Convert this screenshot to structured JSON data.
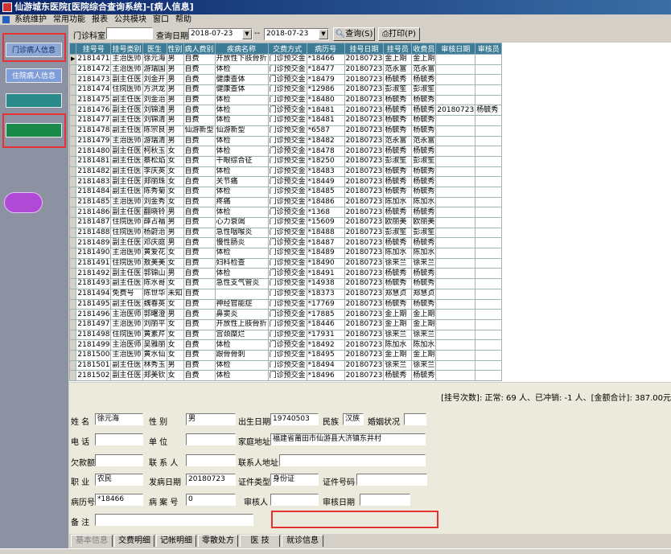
{
  "window": {
    "title": "仙游城东医院[医院综合查询系统]-[病人信息]"
  },
  "menu": [
    "系统维护",
    "常用功能",
    "报表",
    "公共模块",
    "窗口",
    "帮助"
  ],
  "sidebar": {
    "outpatient": "门诊病人信息",
    "inpatient": "住院病人信息",
    "item3": "",
    "item4": "",
    "item5": ""
  },
  "toolbar": {
    "dept_label": "门诊科室",
    "dept_value": "",
    "date_label": "查询日期",
    "date_from": "2018-07-23",
    "date_sep": "--",
    "date_to": "2018-07-23",
    "query": "查询(S)",
    "print": "打印(P)"
  },
  "grid": {
    "headers": [
      "挂号号",
      "挂号类别",
      "医生",
      "性别",
      "病人费别",
      "疾病名称",
      "交费方式",
      "病历号",
      "挂号日期",
      "挂号员",
      "收费员",
      "审核日期",
      "审核员"
    ],
    "rows": [
      [
        "2181471",
        "主治医师",
        "徐元海",
        "男",
        "自费",
        "开放性下肢骨折",
        "门诊预交金",
        "*18466",
        "20180723",
        "金上期",
        "金上期",
        "",
        ""
      ],
      [
        "2181472",
        "主治医师",
        "游瑞国",
        "男",
        "自费",
        "体检",
        "门诊预交金",
        "*18477",
        "20180723",
        "范永富",
        "范永富",
        "",
        ""
      ],
      [
        "2181473",
        "副主任医",
        "刘金开",
        "男",
        "自费",
        "健康查体",
        "门诊预交金",
        "*18479",
        "20180723",
        "杨毓秀",
        "杨毓秀",
        "",
        ""
      ],
      [
        "2181474",
        "住院医师",
        "方洪龙",
        "男",
        "自费",
        "健康查体",
        "门诊预交金",
        "*12986",
        "20180723",
        "彭淑笙",
        "彭淑笙",
        "",
        ""
      ],
      [
        "2181475",
        "副主任医",
        "刘金治",
        "男",
        "自费",
        "体检",
        "门诊预交金",
        "*18480",
        "20180723",
        "杨毓秀",
        "杨毓秀",
        "",
        ""
      ],
      [
        "2181476",
        "副主任医",
        "刘锦清",
        "男",
        "自费",
        "体检",
        "门诊预交金",
        "*18481",
        "20180723",
        "杨毓秀",
        "杨毓秀",
        "20180723",
        "杨毓秀"
      ],
      [
        "2181477",
        "副主任医",
        "刘锦清",
        "男",
        "自费",
        "体检",
        "门诊预交金",
        "*18481",
        "20180723",
        "杨毓秀",
        "杨毓秀",
        "",
        ""
      ],
      [
        "2181478",
        "副主任医",
        "陈宗良",
        "男",
        "仙游新型",
        "仙游新型",
        "门诊预交金",
        "*6587",
        "20180723",
        "杨毓秀",
        "杨毓秀",
        "",
        ""
      ],
      [
        "2181479",
        "主治医师",
        "游瑞清",
        "男",
        "自费",
        "体检",
        "门诊预交金",
        "*18482",
        "20180723",
        "范永富",
        "范永富",
        "",
        ""
      ],
      [
        "2181480",
        "副主任医",
        "柯秋玉",
        "女",
        "自费",
        "体检",
        "门诊预交金",
        "*18478",
        "20180723",
        "杨毓秀",
        "杨毓秀",
        "",
        ""
      ],
      [
        "2181481",
        "副主任医",
        "蔡松焰",
        "女",
        "自费",
        "干眼综合征",
        "门诊预交金",
        "*18250",
        "20180723",
        "彭淑笙",
        "彭淑笙",
        "",
        ""
      ],
      [
        "2181482",
        "副主任医",
        "李庆英",
        "女",
        "自费",
        "体检",
        "门诊预交金",
        "*18483",
        "20180723",
        "杨毓秀",
        "杨毓秀",
        "",
        ""
      ],
      [
        "2181483",
        "副主任医",
        "郑丽珠",
        "女",
        "自费",
        "关节痛",
        "门诊预交金",
        "*18449",
        "20180723",
        "杨毓秀",
        "杨毓秀",
        "",
        ""
      ],
      [
        "2181484",
        "副主任医",
        "陈秀菊",
        "女",
        "自费",
        "体检",
        "门诊预交金",
        "*18485",
        "20180723",
        "杨毓秀",
        "杨毓秀",
        "",
        ""
      ],
      [
        "2181485",
        "主治医师",
        "刘金秀",
        "女",
        "自费",
        "疼痛",
        "门诊预交金",
        "*18486",
        "20180723",
        "陈加水",
        "陈加水",
        "",
        ""
      ],
      [
        "2181486",
        "副主任医",
        "翻晓铃",
        "男",
        "自费",
        "体检",
        "门诊预交金",
        "*1368",
        "20180723",
        "杨毓秀",
        "杨毓秀",
        "",
        ""
      ],
      [
        "2181487",
        "住院医师",
        "薛占福",
        "男",
        "自费",
        "心力衰竭",
        "门诊预交金",
        "*15609",
        "20180723",
        "欧丽美",
        "欧丽美",
        "",
        ""
      ],
      [
        "2181488",
        "住院医师",
        "杨蔚治",
        "男",
        "自费",
        "急性咽喉炎",
        "门诊预交金",
        "*18488",
        "20180723",
        "彭淑笙",
        "彭淑笙",
        "",
        ""
      ],
      [
        "2181489",
        "副主任医",
        "邓庆庭",
        "男",
        "自费",
        "慢性肠炎",
        "门诊预交金",
        "*18487",
        "20180723",
        "杨毓秀",
        "杨毓秀",
        "",
        ""
      ],
      [
        "2181490",
        "主治医师",
        "黄爱花",
        "女",
        "自费",
        "体检",
        "门诊预交金",
        "*18489",
        "20180723",
        "陈加水",
        "陈加水",
        "",
        ""
      ],
      [
        "2181491",
        "住院医师",
        "敖美美",
        "女",
        "自费",
        "妇科检查",
        "门诊预交金",
        "*18490",
        "20180723",
        "徐来兰",
        "徐来兰",
        "",
        ""
      ],
      [
        "2181492",
        "副主任医",
        "郭锦山",
        "男",
        "自费",
        "体检",
        "门诊预交金",
        "*18491",
        "20180723",
        "杨毓秀",
        "杨毓秀",
        "",
        ""
      ],
      [
        "2181493",
        "副主任医",
        "陈水哥",
        "女",
        "自费",
        "急性支气管炎",
        "门诊预交金",
        "*14938",
        "20180723",
        "杨毓秀",
        "杨毓秀",
        "",
        ""
      ],
      [
        "2181494",
        "免费号",
        "陈世华",
        "未知",
        "自费",
        "",
        "门诊预交金",
        "*18373",
        "20180723",
        "郑慧贞",
        "郑慧贞",
        "",
        ""
      ],
      [
        "2181495",
        "副主任医",
        "魏春英",
        "女",
        "自费",
        "神经官能症",
        "门诊预交金",
        "*17769",
        "20180723",
        "杨毓秀",
        "杨毓秀",
        "",
        ""
      ],
      [
        "2181496",
        "主治医师",
        "郭曙澄",
        "男",
        "自费",
        "鼻窦炎",
        "门诊预交金",
        "*17885",
        "20180723",
        "金上期",
        "金上期",
        "",
        ""
      ],
      [
        "2181497",
        "主治医师",
        "刘丽平",
        "女",
        "自费",
        "开放性上肢骨折",
        "门诊预交金",
        "*18446",
        "20180723",
        "金上期",
        "金上期",
        "",
        ""
      ],
      [
        "2181498",
        "住院医师",
        "黄素芹",
        "女",
        "自费",
        "宫颈糜烂",
        "门诊预交金",
        "*17931",
        "20180723",
        "徐来兰",
        "徐来兰",
        "",
        ""
      ],
      [
        "2181499",
        "主治医师",
        "吴雅丽",
        "女",
        "自费",
        "体检",
        "门诊预交金",
        "*18492",
        "20180723",
        "陈加水",
        "陈加水",
        "",
        ""
      ],
      [
        "2181500",
        "主治医师",
        "黄水仙",
        "女",
        "自费",
        "跟骨骨刺",
        "门诊预交金",
        "*18495",
        "20180723",
        "金上期",
        "金上期",
        "",
        ""
      ],
      [
        "2181501",
        "副主任医",
        "林秀玉",
        "男",
        "自费",
        "体检",
        "门诊预交金",
        "*18494",
        "20180723",
        "徐来兰",
        "徐来兰",
        "",
        ""
      ],
      [
        "2181502",
        "副主任医",
        "郑美钦",
        "女",
        "自费",
        "体检",
        "门诊预交金",
        "*18496",
        "20180723",
        "杨毓秀",
        "杨毓秀",
        "",
        ""
      ]
    ]
  },
  "summary": "[挂号次数]: 正常: 69 人、已冲销: -1 人、[金额合计]: 387.00元",
  "form": {
    "name_label": "姓    名",
    "name": "徐元海",
    "sex_label": "性    别",
    "sex": "男",
    "birth_label": "出生日期",
    "birth": "19740503",
    "ethnic_label": "民族",
    "ethnic": "汉族",
    "marital_label": "婚姻状况",
    "marital": "",
    "phone_label": "电    话",
    "phone": "",
    "unit_label": "单    位",
    "unit": "",
    "address_label": "家庭地址",
    "address": "福建省莆田市仙游县大济镇东井村",
    "debt_label": "欠款额",
    "debt": "",
    "contact_label": "联 系 人",
    "contact": "",
    "contact_addr_label": "联系人地址",
    "contact_addr": "",
    "job_label": "职    业",
    "job": "农民",
    "onset_label": "发病日期",
    "onset": "20180723",
    "idtype_label": "证件类型",
    "idtype": "身份证",
    "idno_label": "证件号码",
    "idno": "",
    "record_label": "病历号",
    "record": "*18466",
    "case_label": "病 案 号",
    "case": "0",
    "reviewer_label": "审核人",
    "reviewer": "",
    "review_date_label": "审核日期",
    "review_date": "",
    "note_label": "备    注",
    "note": ""
  },
  "tabs": [
    "基本信息",
    "交费明细",
    "记帐明细",
    "零散处方",
    "医    技",
    "就诊信息"
  ],
  "colors": {
    "grid_header": "#3c7c96",
    "highlight": "#e53333",
    "title_bar": "#0a246a"
  }
}
